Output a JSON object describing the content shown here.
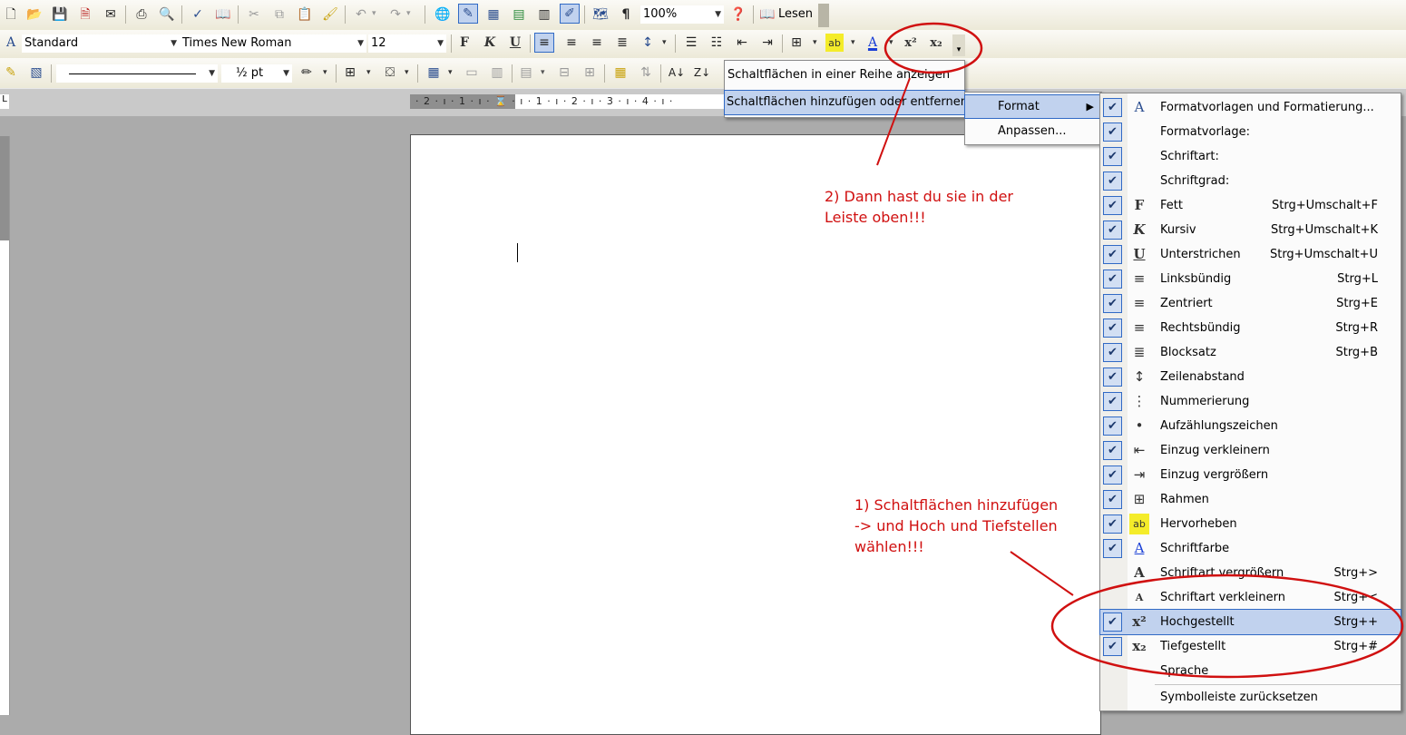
{
  "toolbar_standard": {
    "zoom": "100%",
    "read_label": "Lesen"
  },
  "toolbar_format": {
    "style": "Standard",
    "font": "Times New Roman",
    "size": "12",
    "bold_glyph": "F",
    "italic_glyph": "K",
    "underline_glyph": "U",
    "superscript_glyph": "x²",
    "subscript_glyph": "x₂"
  },
  "toolbar_draw": {
    "line_weight": "½ pt"
  },
  "ruler": {
    "text": "· 2 · ı · 1 · ı · ⌛ · ı · 1 · ı · 2 · ı · 3 · ı · 4 · ı ·"
  },
  "customize_popup": {
    "item1": "Schaltflächen in einer Reihe anzeigen",
    "item2": "Schaltflächen hinzufügen oder entfernen"
  },
  "format_submenu": {
    "item1": "Format",
    "item2": "Anpassen..."
  },
  "buttons_menu": {
    "rows": [
      {
        "icon": "A",
        "label": "Formatvorlagen und Formatierung...",
        "shortcut": "",
        "checked": true
      },
      {
        "icon": "",
        "label": "Formatvorlage:",
        "shortcut": "",
        "checked": true
      },
      {
        "icon": "",
        "label": "Schriftart:",
        "shortcut": "",
        "checked": true
      },
      {
        "icon": "",
        "label": "Schriftgrad:",
        "shortcut": "",
        "checked": true
      },
      {
        "icon": "F",
        "label": "Fett",
        "shortcut": "Strg+Umschalt+F",
        "checked": true
      },
      {
        "icon": "K",
        "label": "Kursiv",
        "shortcut": "Strg+Umschalt+K",
        "checked": true
      },
      {
        "icon": "U",
        "label": "Unterstrichen",
        "shortcut": "Strg+Umschalt+U",
        "checked": true
      },
      {
        "icon": "≡",
        "label": "Linksbündig",
        "shortcut": "Strg+L",
        "checked": true
      },
      {
        "icon": "≡",
        "label": "Zentriert",
        "shortcut": "Strg+E",
        "checked": true
      },
      {
        "icon": "≡",
        "label": "Rechtsbündig",
        "shortcut": "Strg+R",
        "checked": true
      },
      {
        "icon": "≣",
        "label": "Blocksatz",
        "shortcut": "Strg+B",
        "checked": true
      },
      {
        "icon": "↕",
        "label": "Zeilenabstand",
        "shortcut": "",
        "checked": true
      },
      {
        "icon": "⋮",
        "label": "Nummerierung",
        "shortcut": "",
        "checked": true
      },
      {
        "icon": "•",
        "label": "Aufzählungszeichen",
        "shortcut": "",
        "checked": true
      },
      {
        "icon": "⇤",
        "label": "Einzug verkleinern",
        "shortcut": "",
        "checked": true
      },
      {
        "icon": "⇥",
        "label": "Einzug vergrößern",
        "shortcut": "",
        "checked": true
      },
      {
        "icon": "⊞",
        "label": "Rahmen",
        "shortcut": "",
        "checked": true
      },
      {
        "icon": "ab",
        "label": "Hervorheben",
        "shortcut": "",
        "checked": true
      },
      {
        "icon": "A",
        "label": "Schriftfarbe",
        "shortcut": "",
        "checked": true
      },
      {
        "icon": "A",
        "label": "Schriftart vergrößern",
        "shortcut": "Strg+>",
        "checked": false
      },
      {
        "icon": "A",
        "label": "Schriftart verkleinern",
        "shortcut": "Strg+<",
        "checked": false
      },
      {
        "icon": "x²",
        "label": "Hochgestellt",
        "shortcut": "Strg++",
        "checked": true
      },
      {
        "icon": "x₂",
        "label": "Tiefgestellt",
        "shortcut": "Strg+#",
        "checked": true
      },
      {
        "icon": "",
        "label": "Sprache",
        "shortcut": "",
        "checked": false
      }
    ],
    "reset": "Symbolleiste zurücksetzen"
  },
  "annotations": {
    "note2": "2) Dann hast du sie in der\nLeiste oben!!!",
    "note1": "1) Schaltflächen hinzufügen\n-> und Hoch und Tiefstellen\nwählen!!!"
  },
  "colors": {
    "highlight": "#c1d2ee",
    "highlight_border": "#316ac5",
    "annotation": "#d01010",
    "toolbar": "#ece9d8"
  }
}
